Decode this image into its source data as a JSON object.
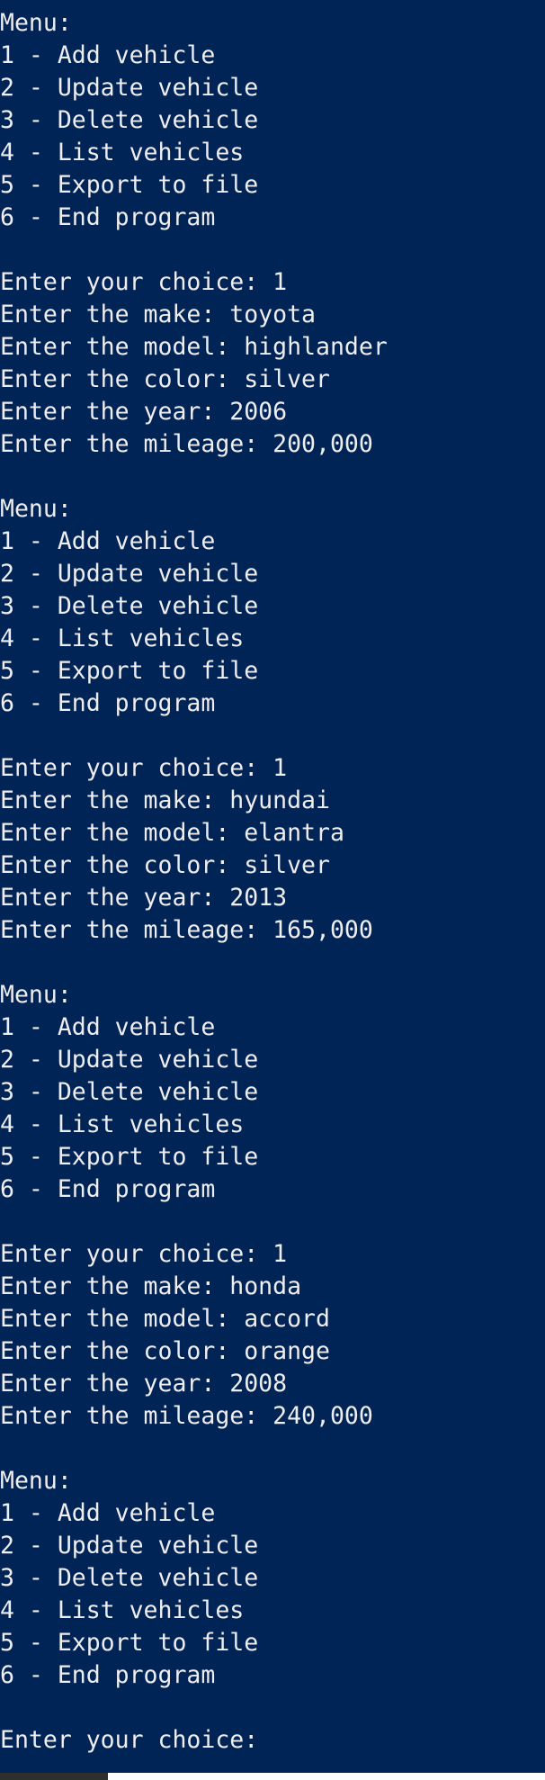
{
  "terminal": {
    "lines": [
      "Menu:",
      "1 - Add vehicle",
      "2 - Update vehicle",
      "3 - Delete vehicle",
      "4 - List vehicles",
      "5 - Export to file",
      "6 - End program",
      "",
      "Enter your choice: 1",
      "Enter the make: toyota",
      "Enter the model: highlander",
      "Enter the color: silver",
      "Enter the year: 2006",
      "Enter the mileage: 200,000",
      "",
      "Menu:",
      "1 - Add vehicle",
      "2 - Update vehicle",
      "3 - Delete vehicle",
      "4 - List vehicles",
      "5 - Export to file",
      "6 - End program",
      "",
      "Enter your choice: 1",
      "Enter the make: hyundai",
      "Enter the model: elantra",
      "Enter the color: silver",
      "Enter the year: 2013",
      "Enter the mileage: 165,000",
      "",
      "Menu:",
      "1 - Add vehicle",
      "2 - Update vehicle",
      "3 - Delete vehicle",
      "4 - List vehicles",
      "5 - Export to file",
      "6 - End program",
      "",
      "Enter your choice: 1",
      "Enter the make: honda",
      "Enter the model: accord",
      "Enter the color: orange",
      "Enter the year: 2008",
      "Enter the mileage: 240,000",
      "",
      "Menu:",
      "1 - Add vehicle",
      "2 - Update vehicle",
      "3 - Delete vehicle",
      "4 - List vehicles",
      "5 - Export to file",
      "6 - End program",
      "",
      "Enter your choice: "
    ]
  },
  "colors": {
    "background": "#012456",
    "text": "#eeedf0",
    "scrollbar_track": "#ffffff",
    "scrollbar_thumb": "#2f2f2f"
  }
}
